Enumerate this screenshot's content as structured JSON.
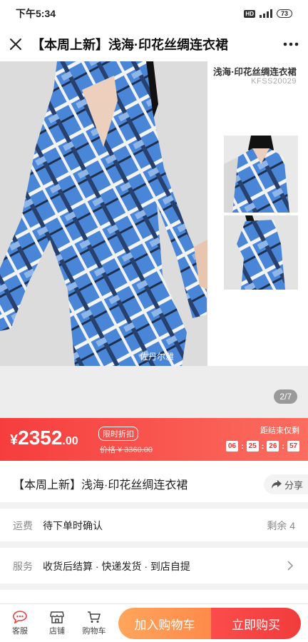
{
  "status_bar": {
    "time": "下午5:34",
    "hd": "HD",
    "network": "4G+",
    "battery": "73"
  },
  "header": {
    "title": "【本周上新】浅海·印花丝绸连衣裙",
    "close_icon": "close-icon",
    "more_icon": "more-icon"
  },
  "gallery": {
    "side_title": "浅海·印花丝绸连衣裙",
    "side_code": "KFSS20029",
    "watermark": "佐丹尔雅",
    "page_indicator": "2/7"
  },
  "price_bar": {
    "currency": "¥",
    "price_int": "2352",
    "price_dec": ".00",
    "promo_tag": "限时折扣",
    "original_price": "价格 ¥ 3360.00",
    "countdown_label": "距结束仅剩",
    "countdown": [
      "06",
      "25",
      "26",
      "57"
    ]
  },
  "product": {
    "name": "【本周上新】浅海·印花丝绸连衣裙",
    "share_label": "分享"
  },
  "shipping": {
    "label": "运费",
    "value": "待下单时确认",
    "remaining": "剩余 4"
  },
  "service": {
    "label": "服务",
    "value": "收货后结算 · 快递发货 · 到店自提"
  },
  "bottom_nav": {
    "items": [
      {
        "label": "客服",
        "icon": "chat-icon"
      },
      {
        "label": "店铺",
        "icon": "store-icon"
      },
      {
        "label": "购物车",
        "icon": "cart-icon"
      }
    ],
    "add_to_cart": "加入购物车",
    "buy_now": "立即购买"
  },
  "colors": {
    "accent_red": "#f23c3c",
    "cart_orange": "#ff9a52",
    "dress_blue": "#3d7fd6"
  }
}
